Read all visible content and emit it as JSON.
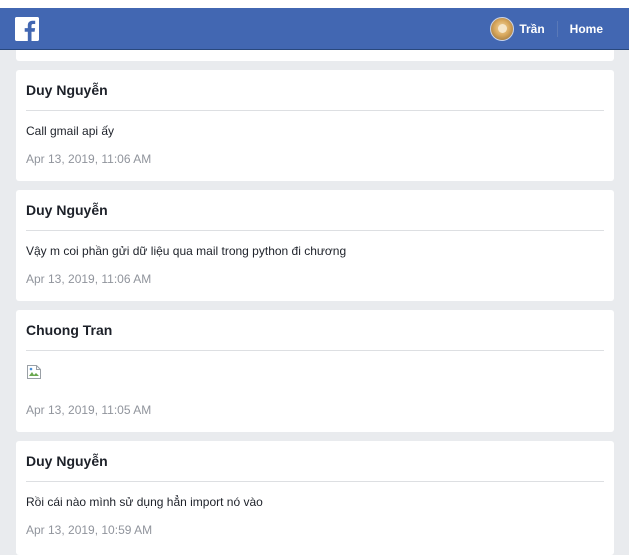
{
  "navbar": {
    "brand_color": "#4267b2",
    "logo_icon": "facebook-f-icon",
    "user_name": "Trần",
    "home_label": "Home"
  },
  "messages": [
    {
      "author": "Duy Nguyễn",
      "text": "Call gmail api ấy",
      "time": "Apr 13, 2019, 11:06 AM"
    },
    {
      "author": "Duy Nguyễn",
      "text": "Vậy m coi phần gửi dữ liệu qua mail trong python đi chương",
      "time": "Apr 13, 2019, 11:06 AM"
    },
    {
      "author": "Chuong Tran",
      "attachment_icon": "broken-image-icon",
      "time": "Apr 13, 2019, 11:05 AM"
    },
    {
      "author": "Duy Nguyễn",
      "text": "Rồi cái nào mình sử dụng hẳn import nó vào",
      "time": "Apr 13, 2019, 10:59 AM"
    }
  ]
}
